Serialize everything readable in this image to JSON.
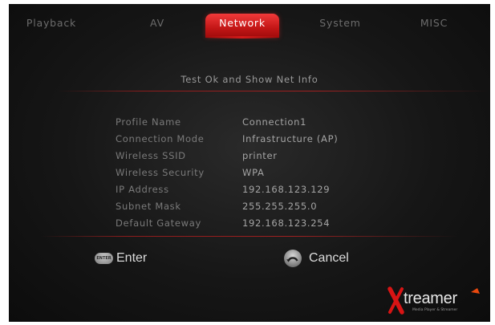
{
  "tabs": [
    {
      "label": "Playback",
      "active": false
    },
    {
      "label": "AV",
      "active": false
    },
    {
      "label": "Network",
      "active": true
    },
    {
      "label": "System",
      "active": false
    },
    {
      "label": "MISC",
      "active": false
    }
  ],
  "status_message": "Test Ok and Show Net Info",
  "net_info": [
    {
      "label": "Profile Name",
      "value": "Connection1"
    },
    {
      "label": "Connection Mode",
      "value": "Infrastructure (AP)"
    },
    {
      "label": "Wireless SSID",
      "value": "printer"
    },
    {
      "label": "Wireless Security",
      "value": "WPA"
    },
    {
      "label": "IP Address",
      "value": "192.168.123.129"
    },
    {
      "label": "Subnet Mask",
      "value": "255.255.255.0"
    },
    {
      "label": "Default Gateway",
      "value": "192.168.123.254"
    }
  ],
  "buttons": {
    "enter": {
      "icon": "enter-key-icon",
      "icon_text": "ENTER",
      "label": "Enter"
    },
    "cancel": {
      "icon": "return-arrow-icon",
      "label": "Cancel"
    }
  },
  "logo": {
    "brand": "treamer",
    "tagline": "Media Player & Streamer"
  },
  "colors": {
    "accent": "#d11a1a",
    "background": "#161616",
    "text": "#a4a4a4"
  }
}
